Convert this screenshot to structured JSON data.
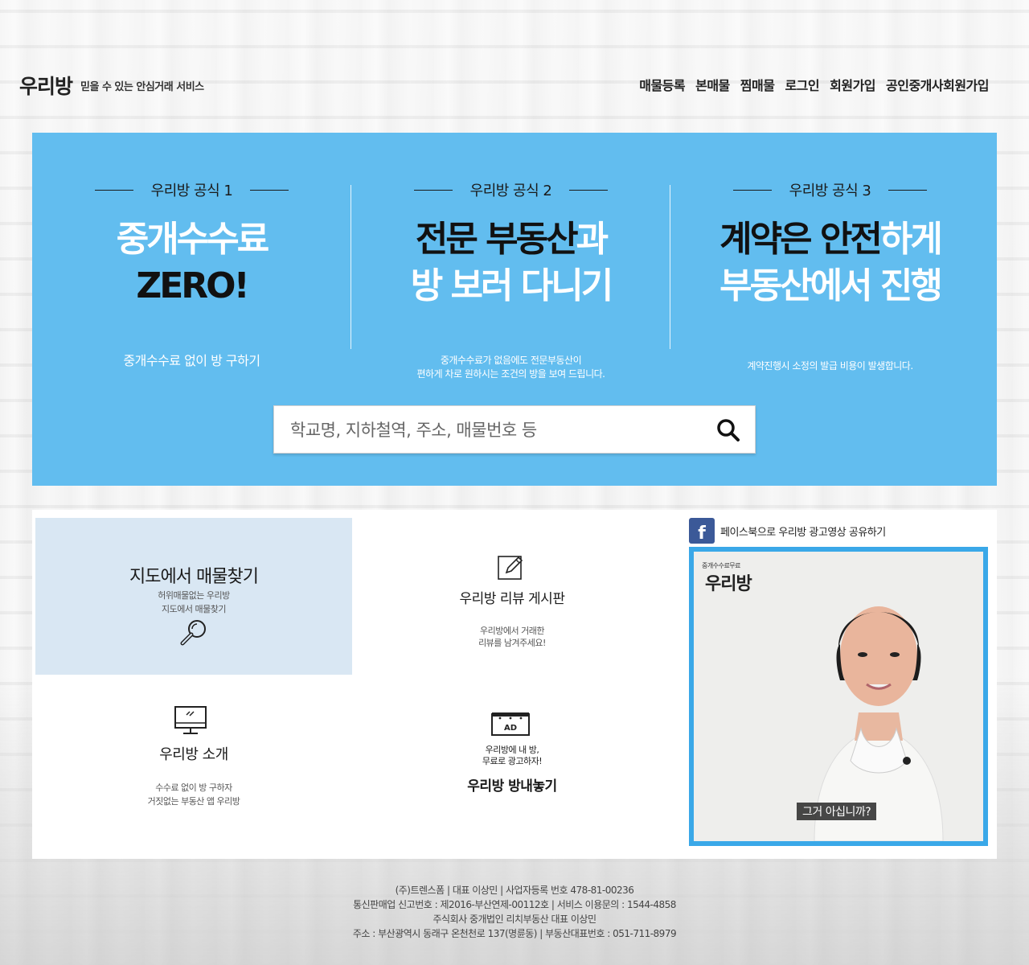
{
  "header": {
    "logo": "우리방",
    "tagline": "믿을 수 있는 안심거래 서비스",
    "nav": [
      "매물등록",
      "본매물",
      "찜매물",
      "로그인",
      "회원가입",
      "공인중개사회원가입"
    ]
  },
  "hero": {
    "columns": [
      {
        "formula": "우리방 공식 1",
        "headline_line1": "중개수수료",
        "headline_line2": "ZERO!",
        "sub": "중개수수료 없이 방 구하기"
      },
      {
        "formula": "우리방 공식 2",
        "headline_line1_a": "전문 부동산",
        "headline_line1_b": "과",
        "headline_line2": "방 보러 다니기",
        "sub_line1": "중개수수료가 없음에도 전문부동산이",
        "sub_line2": "편하게 차로 원하시는 조건의 방을 보여 드립니다."
      },
      {
        "formula": "우리방 공식 3",
        "headline_line1_a": "계약은 안전",
        "headline_line1_b": "하게",
        "headline_line2": "부동산에서 진행",
        "sub": "계약진행시 소정의 발급 비용이 발생합니다."
      }
    ],
    "search": {
      "placeholder": "학교명, 지하철역, 주소, 매물번호 등",
      "icon": "search-icon"
    },
    "colors": {
      "background": "#62bdef"
    }
  },
  "tiles": {
    "map": {
      "title": "지도에서 매물찾기",
      "desc_line1": "허위매물없는 우리방",
      "desc_line2": "지도에서 매물찾기",
      "icon": "magnifier-icon"
    },
    "review": {
      "title": "우리방 리뷰 게시판",
      "desc_line1": "우리방에서 거래한",
      "desc_line2": "리뷰를 남겨주세요!",
      "icon": "pencil-icon"
    },
    "intro": {
      "title": "우리방 소개",
      "desc_line1": "수수료 없이 방 구하자",
      "desc_line2": "거짓없는 부동산 앱 우리방",
      "icon": "monitor-icon"
    },
    "ad": {
      "icon_label": "AD",
      "desc_line1": "우리방에 내 방,",
      "desc_line2": "무료로 광고하자!",
      "title": "우리방 방내놓기",
      "icon": "ad-board-icon"
    }
  },
  "facebook": {
    "icon_label": "f",
    "text": "페이스북으로 우리방 광고영상 공유하기"
  },
  "video": {
    "logo_small": "중개수수료무료",
    "logo": "우리방",
    "caption": "그거 아십니까?"
  },
  "footer": {
    "lines": [
      "(주)트렌스폼 | 대표 이상민 | 사업자등록 번호 478-81-00236",
      "통신판매업 신고번호 : 제2016-부산연제-00112호 | 서비스 이용문의 : 1544-4858",
      "주식회사 중개법인 리치부동산 대표 이상민",
      "주소 : 부산광역시 동래구 온천천로 137(명륜동) | 부동산대표번호 : 051-711-8979"
    ]
  }
}
